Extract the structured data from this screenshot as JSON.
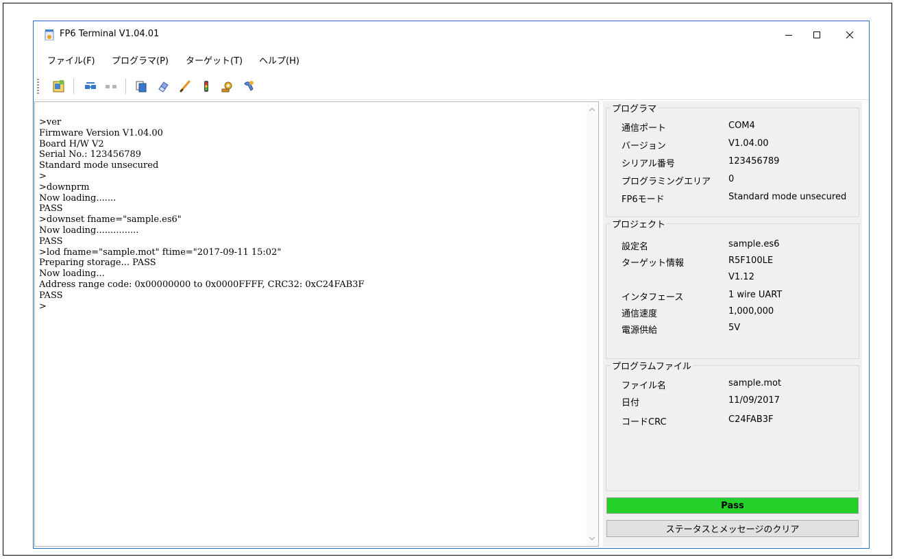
{
  "window": {
    "title": "FP6 Terminal V1.04.01"
  },
  "menu": [
    {
      "label": "ファイル(F)"
    },
    {
      "label": "プログラマ(P)"
    },
    {
      "label": "ターゲット(T)"
    },
    {
      "label": "ヘルプ(H)"
    }
  ],
  "toolbar": {
    "icons": [
      "open-project-icon",
      "connect-icon",
      "disconnect-icon",
      "copy-icon",
      "erase-icon",
      "write-icon",
      "status-light-icon",
      "settings-icon",
      "tools-icon"
    ]
  },
  "terminal": {
    "text": ">ver\nFirmware Version V1.04.00\nBoard H/W V2\nSerial No.: 123456789\nStandard mode unsecured\n>\n>downprm\nNow loading.......\nPASS\n>downset fname=\"sample.es6\"\nNow loading...............\nPASS\n>lod fname=\"sample.mot\" ftime=\"2017-09-11 15:02\"\nPreparing storage... PASS\nNow loading...\nAddress range code: 0x00000000 to 0x0000FFFF, CRC32: 0xC24FAB3F\nPASS\n>"
  },
  "programmer": {
    "title": "プログラマ",
    "rows": [
      {
        "label": "通信ポート",
        "value": "COM4"
      },
      {
        "label": "バージョン",
        "value": "V1.04.00"
      },
      {
        "label": "シリアル番号",
        "value": "123456789"
      },
      {
        "label": "プログラミングエリア",
        "value": "0"
      },
      {
        "label": "FP6モード",
        "value": "Standard mode unsecured"
      }
    ]
  },
  "project": {
    "title": "プロジェクト",
    "rows": [
      {
        "label": "設定名",
        "value": "sample.es6"
      },
      {
        "label": "ターゲット情報",
        "value": "R5F100LE"
      },
      {
        "label": "",
        "value": "V1.12"
      },
      {
        "label": "インタフェース",
        "value": "1 wire UART"
      },
      {
        "label": "通信速度",
        "value": "1,000,000"
      },
      {
        "label": "電源供給",
        "value": "5V"
      }
    ]
  },
  "program_file": {
    "title": "プログラムファイル",
    "rows": [
      {
        "label": "ファイル名",
        "value": "sample.mot"
      },
      {
        "label": "日付",
        "value": "11/09/2017"
      },
      {
        "label": "コードCRC",
        "value": "C24FAB3F"
      }
    ]
  },
  "status": {
    "text": "Pass",
    "color": "#26d02a"
  },
  "clear_button": {
    "label": "ステータスとメッセージのクリア"
  }
}
